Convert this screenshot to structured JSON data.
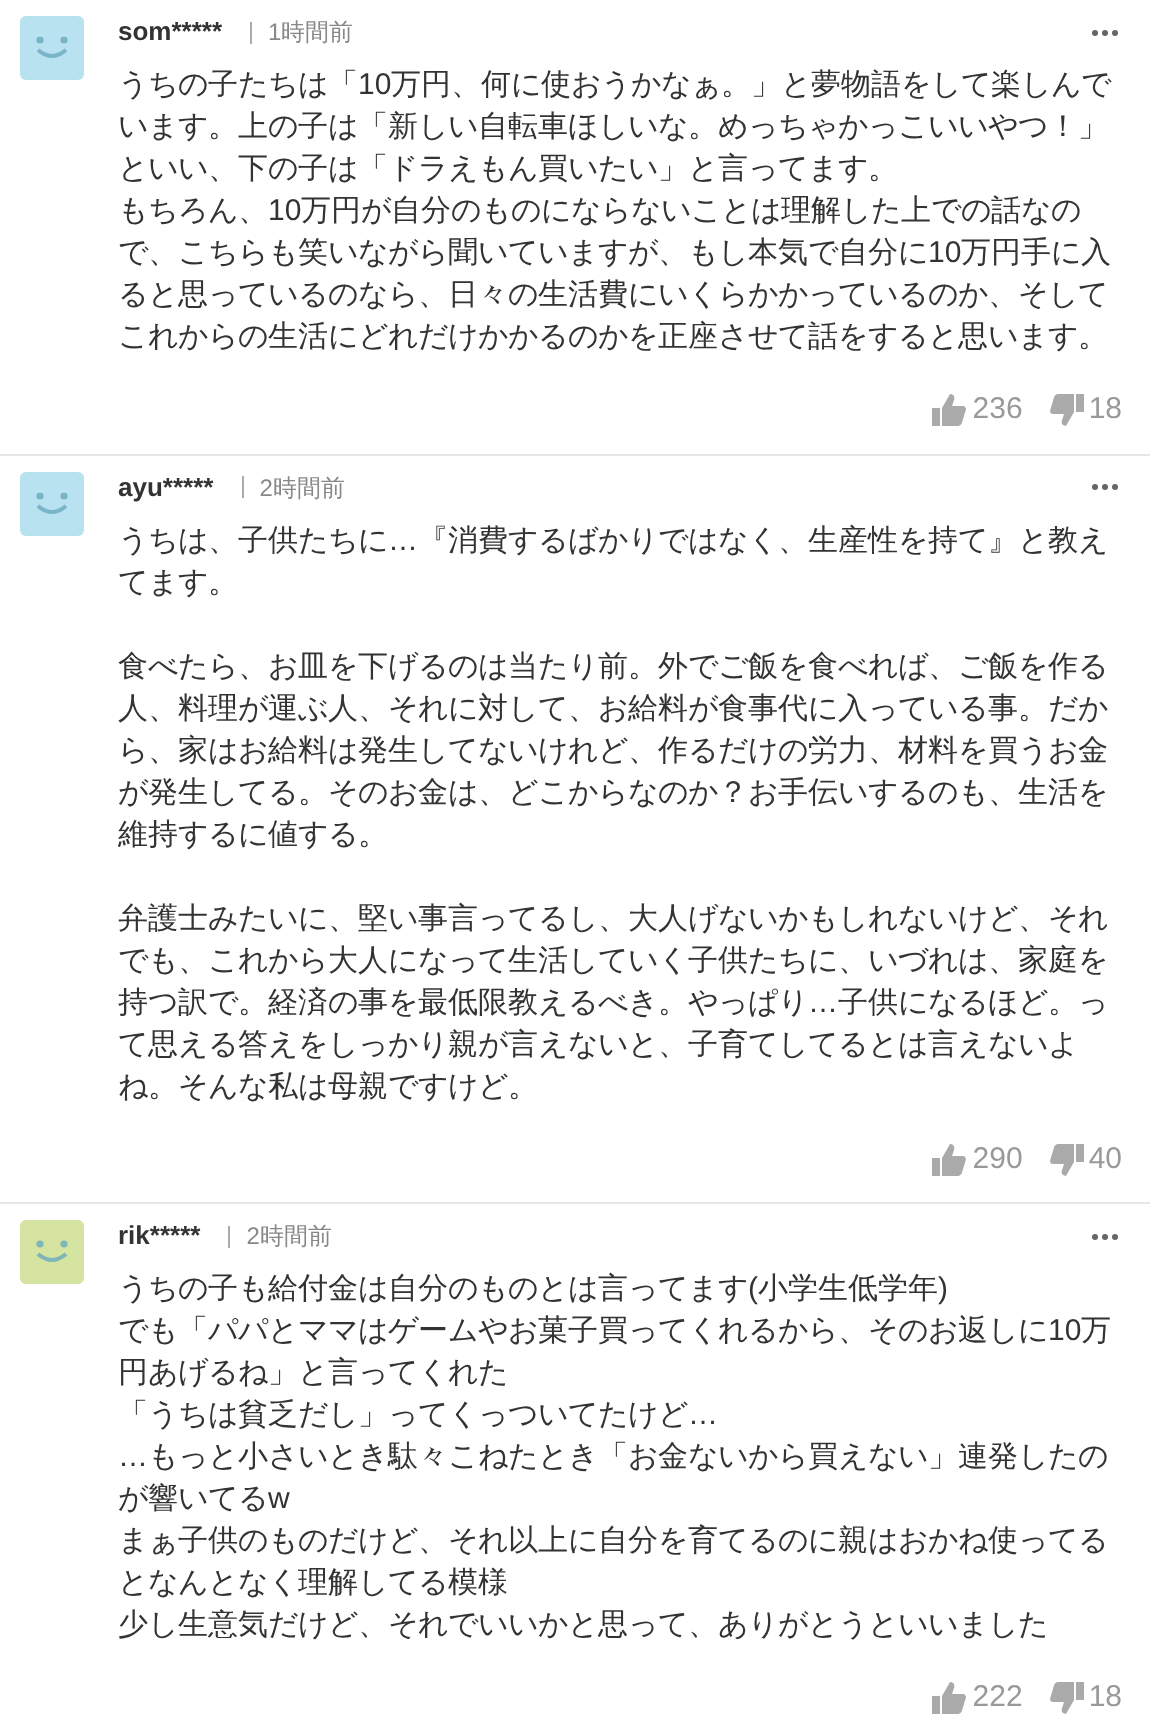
{
  "comments": [
    {
      "user": "som*****",
      "time": "1時間前",
      "color": "#b9e2f0",
      "paragraphs": [
        [
          "うちの子たちは「10万円、何に使おうかなぁ。」と夢物語をして楽しんでいます。上の子は「新しい自転車ほしいな。めっちゃかっこいいやつ！」といい、下の子は「ドラえもん買いたい」と言ってます。",
          "もちろん、10万円が自分のものにならないことは理解した上での話なので、こちらも笑いながら聞いていますが、もし本気で自分に10万円手に入ると思っているのなら、日々の生活費にいくらかかっているのか、そしてこれからの生活にどれだけかかるのかを正座させて話をすると思います。"
        ]
      ],
      "likes": "236",
      "dislikes": "18"
    },
    {
      "user": "ayu*****",
      "time": "2時間前",
      "color": "#b9e2f0",
      "paragraphs": [
        [
          "うちは、子供たちに…『消費するばかりではなく、生産性を持て』と教えてます。"
        ],
        [
          "食べたら、お皿を下げるのは当たり前。外でご飯を食べれば、ご飯を作る人、料理が運ぶ人、それに対して、お給料が食事代に入っている事。だから、家はお給料は発生してないけれど、作るだけの労力、材料を買うお金が発生してる。そのお金は、どこからなのか？お手伝いするのも、生活を維持するに値する。"
        ],
        [
          "弁護士みたいに、堅い事言ってるし、大人げないかもしれないけど、それでも、これから大人になって生活していく子供たちに、いづれは、家庭を持つ訳で。経済の事を最低限教えるべき。やっぱり…子供になるほど。って思える答えをしっかり親が言えないと、子育てしてるとは言えないよね。そんな私は母親ですけど。"
        ]
      ],
      "likes": "290",
      "dislikes": "40"
    },
    {
      "user": "rik*****",
      "time": "2時間前",
      "color": "#d5e4a0",
      "paragraphs": [
        [
          "うちの子も給付金は自分のものとは言ってます(小学生低学年)",
          "でも「パパとママはゲームやお菓子買ってくれるから、そのお返しに10万円あげるね」と言ってくれた",
          "「うちは貧乏だし」ってくっついてたけど…",
          "…もっと小さいとき駄々こねたとき「お金ないから買えない」連発したのが響いてるw",
          "まぁ子供のものだけど、それ以上に自分を育てるのに親はおかね使ってるとなんとなく理解してる模様",
          "少し生意気だけど、それでいいかと思って、ありがとうといいました"
        ]
      ],
      "likes": "222",
      "dislikes": "18"
    }
  ]
}
